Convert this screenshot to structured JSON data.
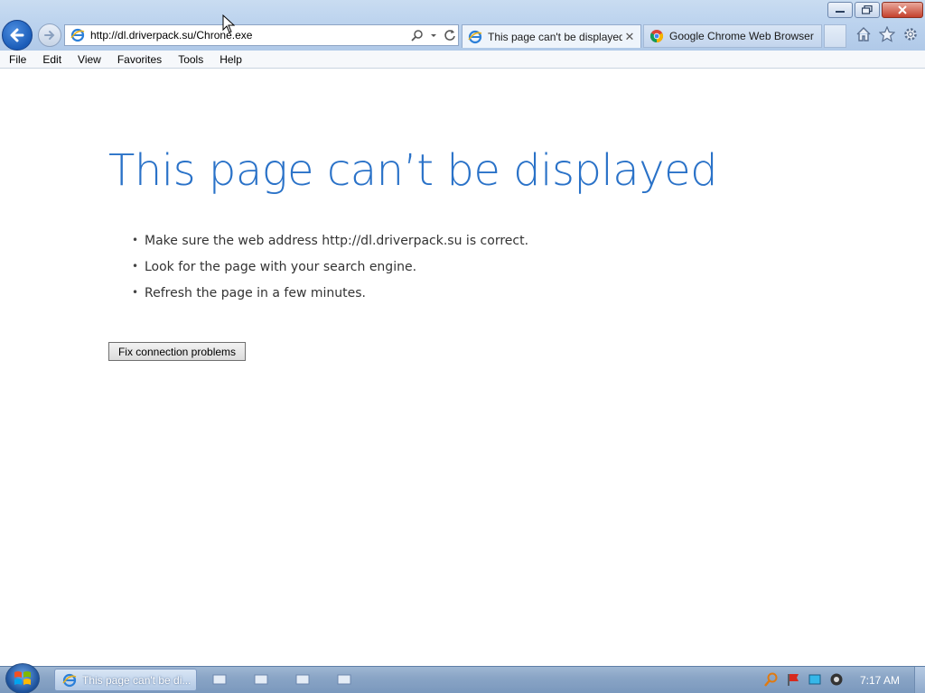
{
  "window": {
    "controls": {
      "minimize_icon": "minimize-icon",
      "restore_icon": "restore-icon",
      "close_icon": "close-icon"
    }
  },
  "nav": {
    "back_icon": "back-arrow-icon",
    "forward_icon": "forward-arrow-icon"
  },
  "addressbar": {
    "url": "http://dl.driverpack.su/Chrone.exe",
    "search_icon": "search-icon",
    "dropdown_icon": "chevron-down-icon",
    "refresh_icon": "refresh-icon"
  },
  "tabs": [
    {
      "label": "This page can't be displayed",
      "icon": "ie-icon",
      "active": true
    },
    {
      "label": "Google Chrome Web Browser",
      "icon": "chrome-icon",
      "active": false
    }
  ],
  "toolbar_icons": [
    "home-icon",
    "favorites-star-icon",
    "gear-icon"
  ],
  "menubar": {
    "items": [
      "File",
      "Edit",
      "View",
      "Favorites",
      "Tools",
      "Help"
    ]
  },
  "page": {
    "title": "This page can’t be displayed",
    "tips": [
      "Make sure the web address http://dl.driverpack.su is correct.",
      "Look for the page with your search engine.",
      "Refresh the page in a few minutes."
    ],
    "fix_button": "Fix connection problems"
  },
  "taskbar": {
    "task_label": "This page can't be di...",
    "clock": "7:17 AM"
  },
  "colors": {
    "title_blue": "#2a72c8",
    "frame_blue": "#bcd3ee"
  }
}
